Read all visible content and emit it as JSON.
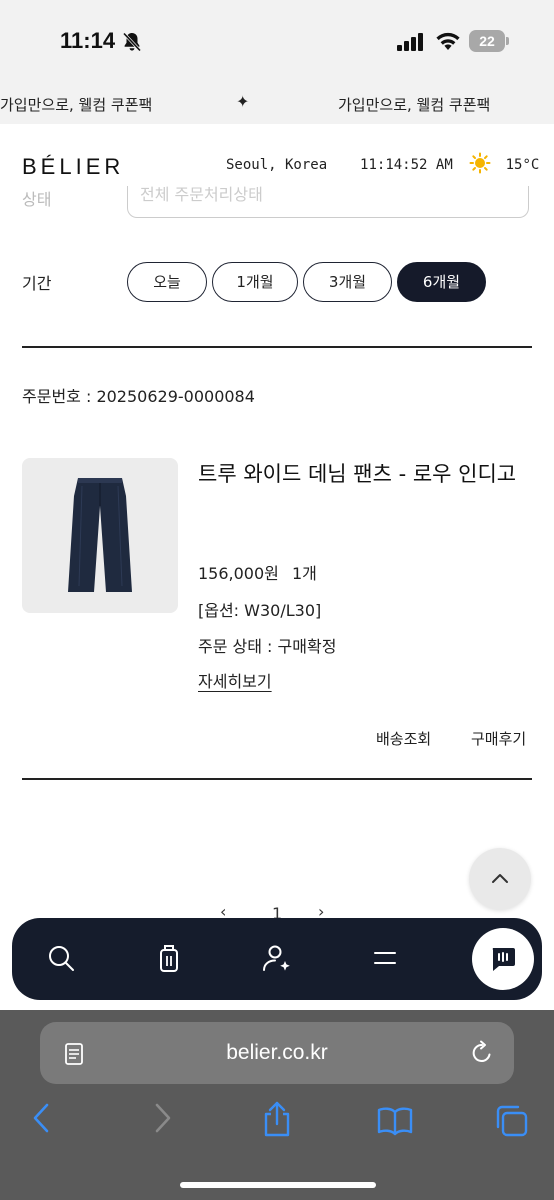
{
  "status_bar": {
    "time": "11:14",
    "battery": "22"
  },
  "promo": {
    "left_text": "가입만으로, 웰컴 쿠폰팩",
    "separator": "✦",
    "right_text": "가입만으로, 웰컴 쿠폰팩"
  },
  "header": {
    "logo": "BÉLIER",
    "location": "Seoul, Korea",
    "clock": "11:14:52 AM",
    "temperature": "15°C"
  },
  "filters": {
    "status_label": "상태",
    "status_value": "전체 주문처리상태",
    "period_label": "기간",
    "periods": [
      "오늘",
      "1개월",
      "3개월",
      "6개월"
    ],
    "active_period": "6개월"
  },
  "order": {
    "order_number": "주문번호 : 20250629-0000084",
    "product_name": "트루 와이드 데님 팬츠 - 로우 인디고",
    "price": "156,000원",
    "quantity": "1개",
    "option": "[옵션: W30/L30]",
    "status": "주문 상태 : 구매확정",
    "detail_link": "자세히보기",
    "actions": [
      "배송조회",
      "구매후기"
    ]
  },
  "pagination": {
    "prev": "‹",
    "current": "1",
    "next": "›"
  },
  "app_nav": {
    "icons": [
      "search-icon",
      "shopping-bag-icon",
      "user-star-icon",
      "menu-icon",
      "chat-icon"
    ]
  },
  "browser": {
    "url": "belier.co.kr"
  },
  "colors": {
    "navy": "#151c2c",
    "ios_blue": "#3a8ef6"
  }
}
